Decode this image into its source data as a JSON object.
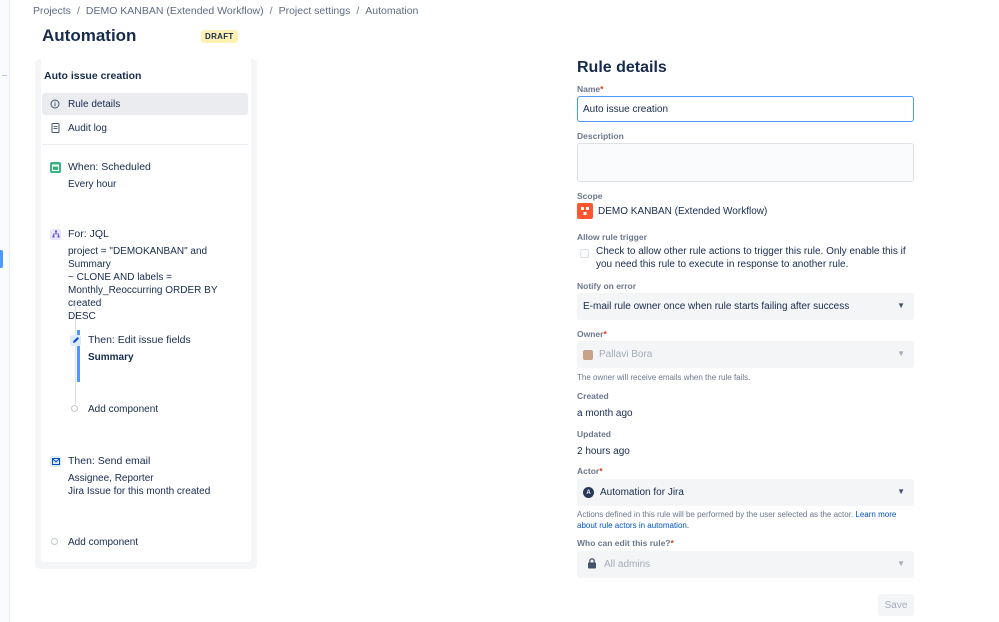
{
  "breadcrumb": {
    "items": [
      "Projects",
      "DEMO KANBAN (Extended Workflow)",
      "Project settings",
      "Automation"
    ],
    "separator": "/"
  },
  "page": {
    "title": "Automation",
    "badge": "DRAFT"
  },
  "rule": {
    "name": "Auto issue creation",
    "nav": [
      {
        "label": "Rule details",
        "icon": "info-icon",
        "active": true
      },
      {
        "label": "Audit log",
        "icon": "document-icon",
        "active": false
      }
    ],
    "components": [
      {
        "heading": "When: Scheduled",
        "text": "Every hour",
        "icon": "calendar-icon",
        "color": "#36b37e"
      },
      {
        "heading": "For: JQL",
        "text": "project = \"DEMOKANBAN\" and Summary\n~ CLONE AND labels =\nMonthly_Reoccurring ORDER BY created\nDESC",
        "icon": "branch-icon",
        "color": "#6554c0"
      },
      {
        "heading": "Then: Edit issue fields",
        "text": "Summary",
        "icon": "pencil-icon",
        "color": "#0065ff"
      },
      {
        "heading": "Then: Send email",
        "text": "Assignee, Reporter\nJira Issue for this month created",
        "icon": "email-icon",
        "color": "#0065ff"
      }
    ],
    "add_component_inner": "Add component",
    "add_component_outer": "Add component"
  },
  "details": {
    "title": "Rule details",
    "name_label": "Name",
    "name_value": "Auto issue creation",
    "description_label": "Description",
    "description_value": "",
    "scope_label": "Scope",
    "scope_value": "DEMO KANBAN (Extended Workflow)",
    "allow_trigger_label": "Allow rule trigger",
    "allow_trigger_text": "Check to allow other rule actions to trigger this rule. Only enable this if you need this rule to execute in response to another rule.",
    "notify_label": "Notify on error",
    "notify_value": "E-mail rule owner once when rule starts failing after success",
    "owner_label": "Owner",
    "owner_value": "Pallavi Bora",
    "owner_help": "The owner will receive emails when the rule fails.",
    "created_label": "Created",
    "created_value": "a month ago",
    "updated_label": "Updated",
    "updated_value": "2 hours ago",
    "actor_label": "Actor",
    "actor_value": "Automation for Jira",
    "actor_help": "Actions defined in this rule will be performed by the user selected as the actor.",
    "actor_help_link": "Learn more about rule actors in automation.",
    "edit_label": "Who can edit this rule?",
    "edit_value": "All admins",
    "save_label": "Save",
    "required_mark": "*"
  },
  "colors": {
    "accent": "#4c9aff",
    "draft_badge": "#fff0b3",
    "scope_icon": "#ff5630",
    "required": "#de350b"
  }
}
